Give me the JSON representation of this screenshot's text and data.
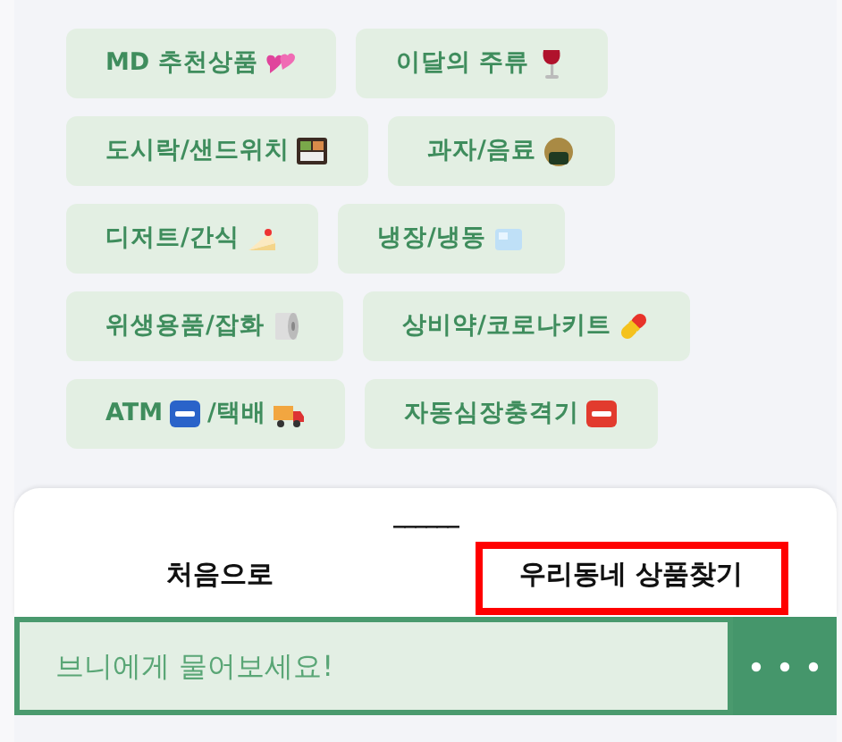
{
  "category_rows": [
    [
      {
        "parts": [
          "MD 추천상품"
        ]
      },
      {
        "parts": [
          "이달의 주류"
        ]
      }
    ],
    [
      {
        "parts": [
          "도시락/샌드위치"
        ]
      },
      {
        "parts": [
          "과자/음료"
        ]
      }
    ],
    [
      {
        "parts": [
          "디저트/간식"
        ]
      },
      {
        "parts": [
          "냉장/냉동"
        ]
      }
    ],
    [
      {
        "parts": [
          "위생용품/잡화"
        ]
      },
      {
        "parts": [
          "상비약/코로나키트"
        ]
      }
    ],
    [
      {
        "parts": [
          "ATM",
          "/택배"
        ]
      },
      {
        "parts": [
          "자동심장충격기"
        ]
      }
    ]
  ],
  "sheet": {
    "handle": "______",
    "actions": [
      {
        "label": "처음으로",
        "highlighted": false
      },
      {
        "label": "우리동네 상품찾기",
        "highlighted": true
      }
    ]
  },
  "chat_input": {
    "placeholder": "브니에게 물어보세요!"
  }
}
